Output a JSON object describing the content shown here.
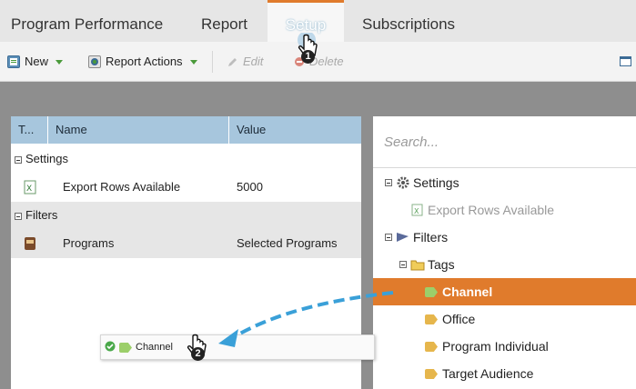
{
  "tabs": [
    {
      "label": "Program Performance"
    },
    {
      "label": "Report"
    },
    {
      "label": "Setup"
    },
    {
      "label": "Subscriptions"
    }
  ],
  "toolbar": {
    "new_label": "New",
    "report_actions_label": "Report Actions",
    "edit_label": "Edit",
    "delete_label": "Delete"
  },
  "grid": {
    "columns": [
      "T...",
      "Name",
      "Value"
    ],
    "groups": [
      {
        "label": "Settings",
        "rows": [
          {
            "name": "Export Rows Available",
            "value": "5000"
          }
        ]
      },
      {
        "label": "Filters",
        "rows": [
          {
            "name": "Programs",
            "value": "Selected Programs"
          }
        ]
      }
    ]
  },
  "tree": {
    "search_placeholder": "Search...",
    "nodes": [
      {
        "label": "Settings",
        "icon": "gear-icon"
      },
      {
        "label": "Export Rows Available",
        "icon": "excel-icon",
        "disabled": true
      },
      {
        "label": "Filters",
        "icon": "funnel-icon"
      },
      {
        "label": "Tags",
        "icon": "folder-icon"
      },
      {
        "label": "Channel",
        "icon": "tag-icon",
        "selected": true
      },
      {
        "label": "Office",
        "icon": "tag-icon"
      },
      {
        "label": "Program Individual",
        "icon": "tag-icon"
      },
      {
        "label": "Target Audience",
        "icon": "tag-icon"
      }
    ]
  },
  "drag": {
    "label": "Channel",
    "step1": "1",
    "step2": "2"
  },
  "colors": {
    "accent": "#e07b2c",
    "header_blue": "#a7c6dd",
    "arrow_blue": "#3aa0d8"
  }
}
